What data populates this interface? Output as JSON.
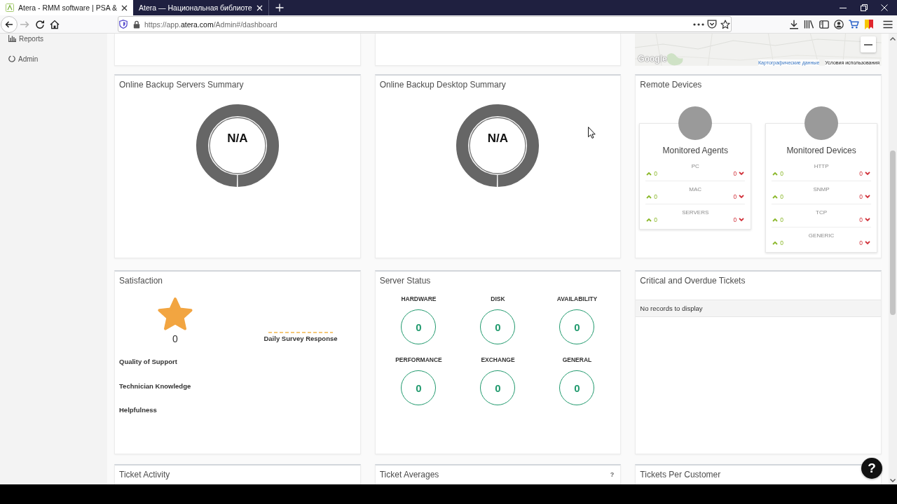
{
  "browser": {
    "tabs": [
      {
        "title": "Atera - RMM software | PSA &",
        "selected": true
      },
      {
        "title": "Atera — Национальная библиоте",
        "selected": false
      }
    ],
    "url": "https://app.**atera.com**/Admin#/dashboard"
  },
  "sidebar": {
    "items": [
      {
        "label": "Reports"
      },
      {
        "label": "Admin"
      }
    ]
  },
  "map": {
    "logo": "Google",
    "data_link": "Картографические данные",
    "terms_link": "Условия использования"
  },
  "widgets": [
    {
      "kind": "backup",
      "title": "Online Backup Servers Summary",
      "center": "N/A"
    },
    {
      "kind": "backup",
      "title": "Online Backup Desktop Summary",
      "center": "N/A"
    },
    {
      "kind": "remote",
      "title": "Remote Devices",
      "groups": [
        {
          "title": "Monitored Agents",
          "rows": [
            {
              "label": "PC",
              "up": "0",
              "down": "0"
            },
            {
              "label": "MAC",
              "up": "0",
              "down": "0"
            },
            {
              "label": "SERVERS",
              "up": "0",
              "down": "0"
            }
          ]
        },
        {
          "title": "Monitored Devices",
          "rows": [
            {
              "label": "HTTP",
              "up": "0",
              "down": "0"
            },
            {
              "label": "SNMP",
              "up": "0",
              "down": "0"
            },
            {
              "label": "TCP",
              "up": "0",
              "down": "0"
            },
            {
              "label": "GENERIC",
              "up": "0",
              "down": "0"
            }
          ]
        }
      ]
    },
    {
      "kind": "satisfaction",
      "title": "Satisfaction",
      "score": "0",
      "legend": "Daily Survey Response",
      "categories": [
        "Quality of Support",
        "Technician Knowledge",
        "Helpfulness"
      ]
    },
    {
      "kind": "server_status",
      "title": "Server Status",
      "items": [
        {
          "label": "HARDWARE",
          "count": "0"
        },
        {
          "label": "DISK",
          "count": "0"
        },
        {
          "label": "AVAILABILITY",
          "count": "0"
        },
        {
          "label": "PERFORMANCE",
          "count": "0"
        },
        {
          "label": "EXCHANGE",
          "count": "0"
        },
        {
          "label": "GENERAL",
          "count": "0"
        }
      ]
    },
    {
      "kind": "tickets",
      "title": "Critical and Overdue Tickets",
      "empty_text": "No records to display"
    },
    {
      "kind": "partial",
      "title": "Ticket Activity"
    },
    {
      "kind": "partial",
      "title": "Ticket Averages",
      "help": "?"
    },
    {
      "kind": "partial",
      "title": "Tickets Per Customer"
    }
  ],
  "help_button": "?"
}
